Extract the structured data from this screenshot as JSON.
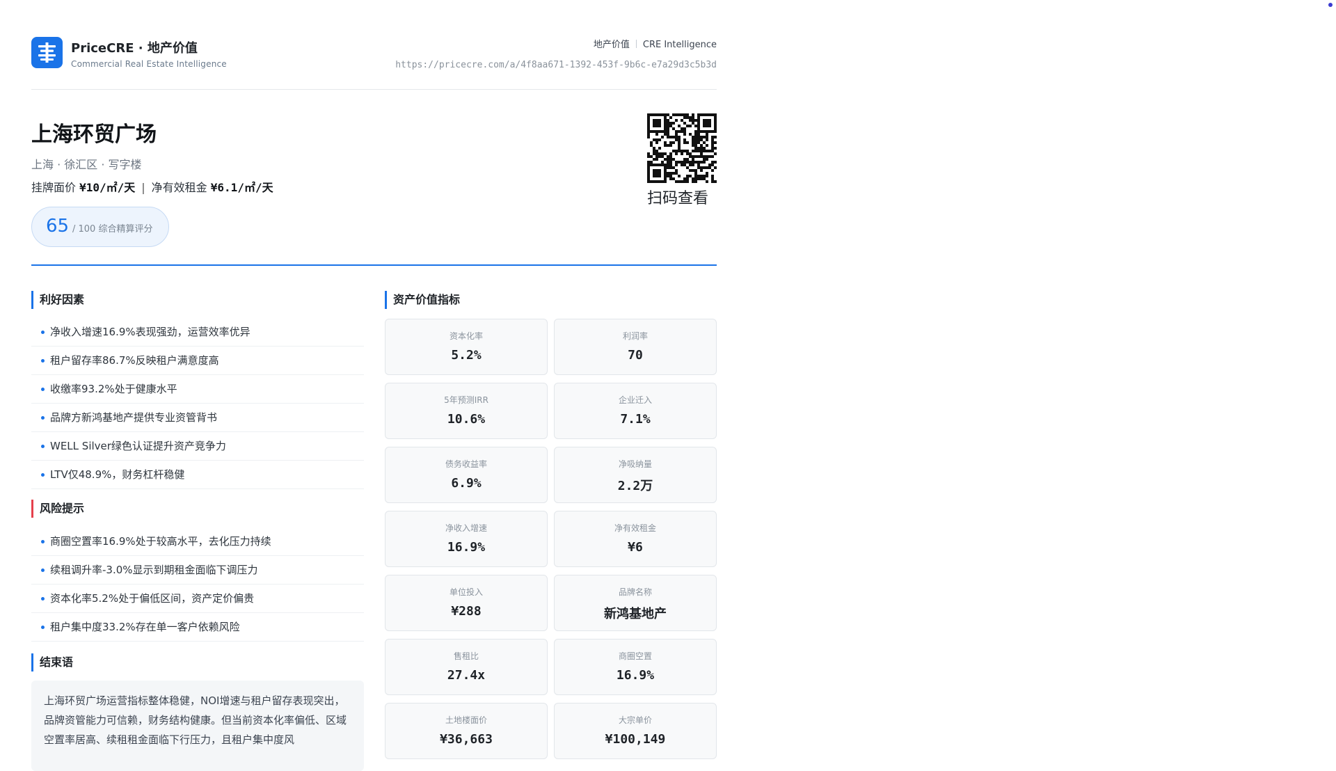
{
  "header": {
    "brand_title": "PriceCRE · 地产价值",
    "brand_subtitle": "Commercial Real Estate Intelligence",
    "link_primary": "地产价值",
    "link_secondary": "CRE Intelligence",
    "url": "https://pricecre.com/a/4f8aa671-1392-453f-9b6c-e7a29d3c5b3d",
    "logo_icon": "building-ledger-icon"
  },
  "property": {
    "name": "上海环贸广场",
    "location": "上海 · 徐汇区 · 写字楼",
    "listing_price_label": "挂牌面价",
    "listing_price_value": "¥10/㎡/天",
    "net_rent_label": "净有效租金",
    "net_rent_value": "¥6.1/㎡/天",
    "score": "65",
    "score_label": "/ 100 综合精算评分",
    "qr_label": "扫码查看"
  },
  "positives": {
    "title": "利好因素",
    "items": [
      "净收入增速16.9%表现强劲，运营效率优异",
      "租户留存率86.7%反映租户满意度高",
      "收缴率93.2%处于健康水平",
      "品牌方新鸿基地产提供专业资管背书",
      " WELL Silver绿色认证提升资产竞争力",
      "LTV仅48.9%，财务杠杆稳健"
    ]
  },
  "risks": {
    "title": "风险提示",
    "items": [
      "商圈空置率16.9%处于较高水平，去化压力持续",
      "续租调升率-3.0%显示到期租金面临下调压力",
      "资本化率5.2%处于偏低区间，资产定价偏贵",
      "租户集中度33.2%存在单一客户依赖风险"
    ]
  },
  "conclusion": {
    "title": "结束语",
    "text": "上海环贸广场运营指标整体稳健，NOI增速与租户留存表现突出，品牌资管能力可信赖，财务结构健康。但当前资本化率偏低、区域空置率居高、续租租金面临下行压力，且租户集中度风"
  },
  "metrics": {
    "title": "资产价值指标",
    "items": [
      {
        "label": "资本化率",
        "value": "5.2%"
      },
      {
        "label": "利润率",
        "value": "70"
      },
      {
        "label": "5年预测IRR",
        "value": "10.6%"
      },
      {
        "label": "企业迁入",
        "value": "7.1%"
      },
      {
        "label": "债务收益率",
        "value": "6.9%"
      },
      {
        "label": "净吸纳量",
        "value": "2.2万"
      },
      {
        "label": "净收入增速",
        "value": "16.9%"
      },
      {
        "label": "净有效租金",
        "value": "¥6"
      },
      {
        "label": "单位投入",
        "value": "¥288"
      },
      {
        "label": "品牌名称",
        "value": "新鸿基地产"
      },
      {
        "label": "售租比",
        "value": "27.4x"
      },
      {
        "label": "商圈空置",
        "value": "16.9%"
      },
      {
        "label": "土地楼面价",
        "value": "¥36,663"
      },
      {
        "label": "大宗单价",
        "value": "¥100,149"
      }
    ]
  },
  "colors": {
    "accent": "#1a73e8",
    "risk": "#e5404c"
  }
}
